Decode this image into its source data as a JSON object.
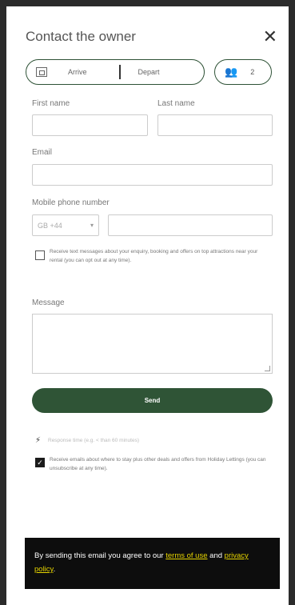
{
  "modal": {
    "title": "Contact the owner",
    "close_label": "✕"
  },
  "dates": {
    "arrive": "Arrive",
    "depart": "Depart"
  },
  "guests": {
    "count": "2"
  },
  "form": {
    "first_name_label": "First name",
    "last_name_label": "Last name",
    "email_label": "Email",
    "phone_label": "Mobile phone number",
    "country_code": "GB +44",
    "sms_consent_text": "Receive text messages about your enquiry, booking and offers on top attractions near your rental (you can opt out at any time).",
    "message_label": "Message",
    "send_label": "Send",
    "response_time_text": "Response time (e.g. < than 60 minutes)",
    "email_consent_text": "Receive emails about where to stay plus other deals and offers from Holiday Lettings (you can unsubscribe at any time)."
  },
  "notice": {
    "prefix": "By sending this email you agree to our ",
    "terms_link": "terms of use",
    "middle": " and ",
    "privacy_link": "privacy policy",
    "suffix": "."
  },
  "colors": {
    "accent": "#2f5436",
    "link": "#e6d400"
  }
}
